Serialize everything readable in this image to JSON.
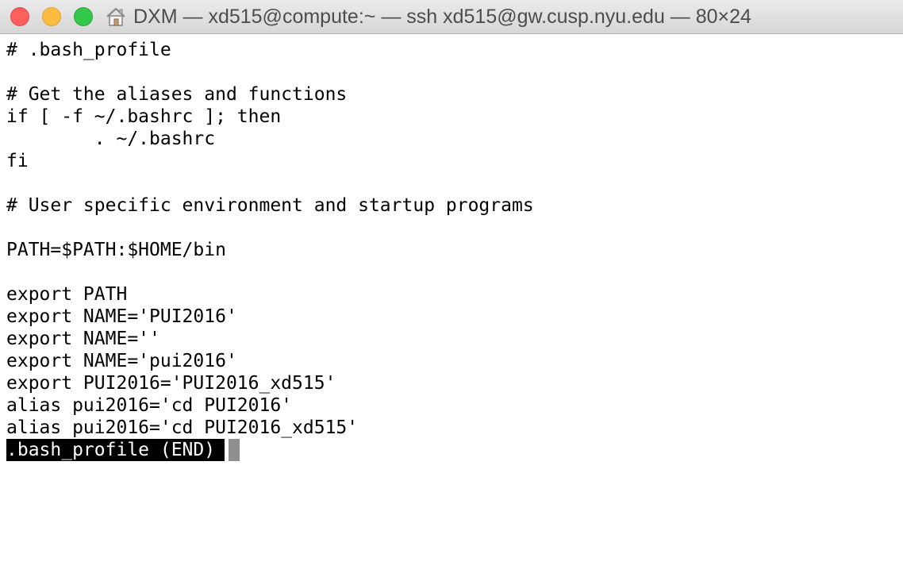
{
  "window": {
    "title": "DXM — xd515@compute:~ — ssh xd515@gw.cusp.nyu.edu — 80×24",
    "title_icon": "home-folder-icon",
    "buttons": {
      "close_icon": "close-icon",
      "minimize_icon": "minimize-icon",
      "zoom_icon": "zoom-icon",
      "close_color": "#fc605c",
      "minimize_color": "#fdbc40",
      "zoom_color": "#34c84a"
    }
  },
  "terminal": {
    "lines": [
      "# .bash_profile",
      "",
      "# Get the aliases and functions",
      "if [ -f ~/.bashrc ]; then",
      "        . ~/.bashrc",
      "fi",
      "",
      "# User specific environment and startup programs",
      "",
      "PATH=$PATH:$HOME/bin",
      "",
      "export PATH",
      "export NAME='PUI2016'",
      "export NAME=''",
      "export NAME='pui2016'",
      "export PUI2016='PUI2016_xd515'",
      "alias pui2016='cd PUI2016'",
      "alias pui2016='cd PUI2016_xd515'"
    ],
    "status": ".bash_profile (END)",
    "background": "#ffffff",
    "foreground": "#000000"
  }
}
